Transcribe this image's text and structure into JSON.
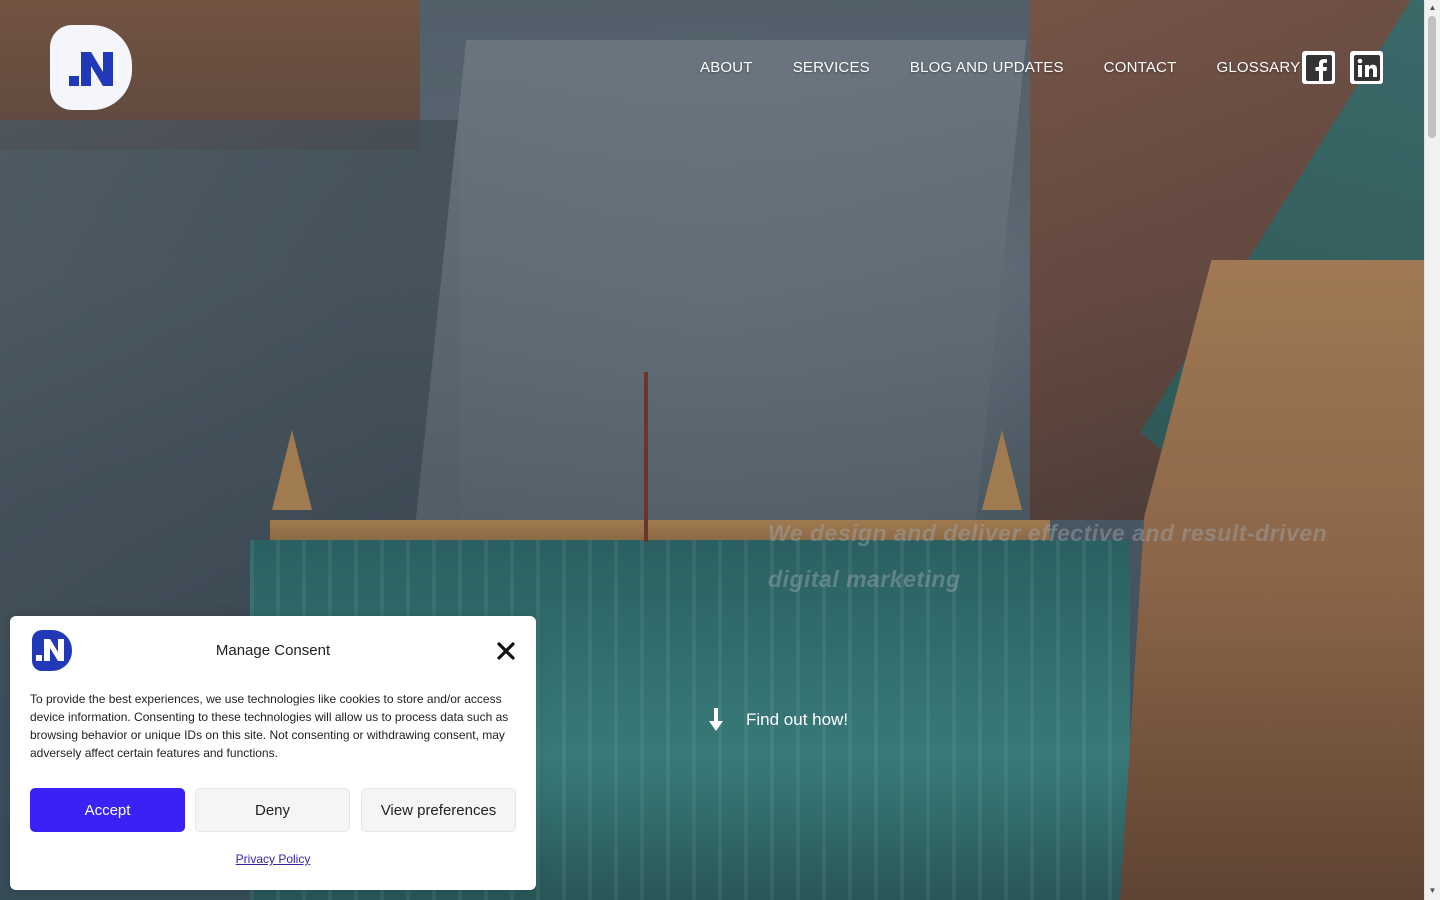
{
  "header": {
    "nav": [
      {
        "label": "ABOUT"
      },
      {
        "label": "SERVICES"
      },
      {
        "label": "BLOG AND UPDATES"
      },
      {
        "label": "CONTACT"
      },
      {
        "label": "GLOSSARY"
      }
    ],
    "social": [
      "facebook-icon",
      "linkedin-icon"
    ]
  },
  "hero": {
    "tagline": "We design and deliver effective and result-driven digital marketing",
    "cta_label": "Find out how!"
  },
  "consent": {
    "title": "Manage Consent",
    "text": "To provide the best experiences, we use technologies like cookies to store and/or access device information. Consenting to these technologies will allow us to process data such as browsing behavior or unique IDs on this site. Not consenting or withdrawing consent, may adversely affect certain features and functions.",
    "accept_label": "Accept",
    "deny_label": "Deny",
    "prefs_label": "View preferences",
    "privacy_label": "Privacy Policy"
  },
  "colors": {
    "brand_blue": "#2138b8",
    "accept_button": "#3a22f5"
  }
}
